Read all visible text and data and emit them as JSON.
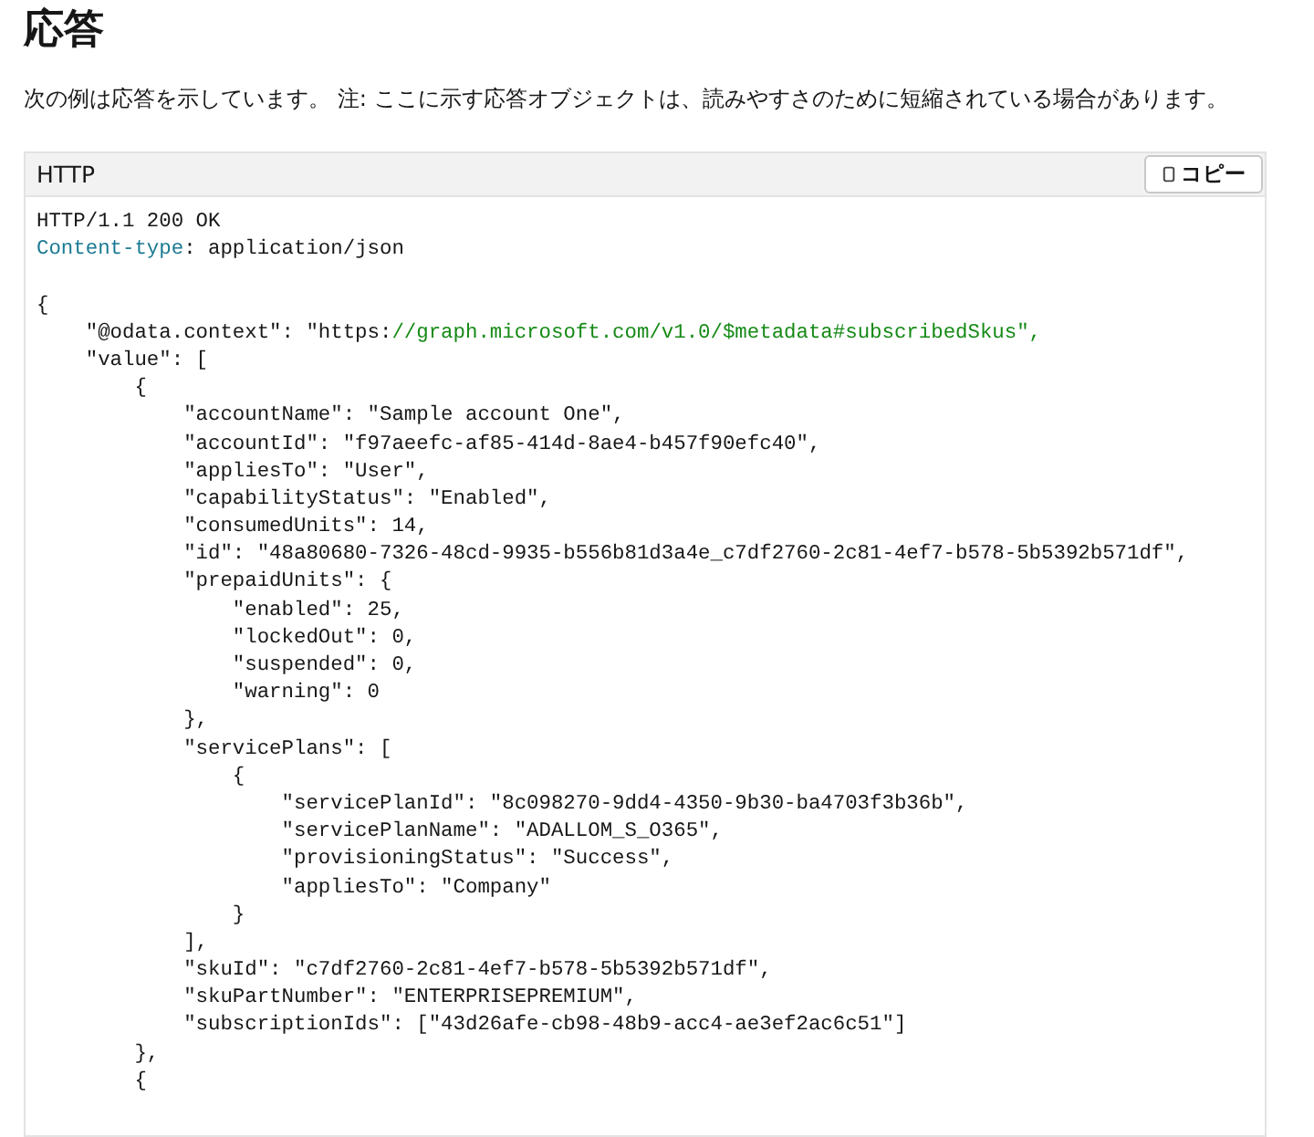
{
  "heading": "応答",
  "description": "次の例は応答を示しています。 注: ここに示す応答オブジェクトは、読みやすさのために短縮されている場合があります。",
  "code_block": {
    "language": "HTTP",
    "copy_button": "コピー",
    "lines": [
      {
        "segments": [
          {
            "kind": "plain",
            "text": "HTTP/1.1 200 OK"
          }
        ]
      },
      {
        "segments": [
          {
            "kind": "header",
            "text": "Content-type"
          },
          {
            "kind": "plain",
            "text": ": application/json"
          }
        ]
      },
      {
        "kind": "blank"
      },
      {
        "segments": [
          {
            "kind": "plain",
            "text": "{"
          }
        ]
      },
      {
        "segments": [
          {
            "kind": "plain",
            "text": "    \"@odata.context\": \"https:"
          },
          {
            "kind": "url",
            "text": "//graph.microsoft.com/v1.0/$metadata#subscribedSkus\","
          }
        ]
      },
      {
        "segments": [
          {
            "kind": "plain",
            "text": "    \"value\": ["
          }
        ]
      },
      {
        "segments": [
          {
            "kind": "plain",
            "text": "        {"
          }
        ]
      },
      {
        "segments": [
          {
            "kind": "plain",
            "text": "            \"accountName\": \"Sample account One\","
          }
        ]
      },
      {
        "segments": [
          {
            "kind": "plain",
            "text": "            \"accountId\": \"f97aeefc-af85-414d-8ae4-b457f90efc40\","
          }
        ]
      },
      {
        "segments": [
          {
            "kind": "plain",
            "text": "            \"appliesTo\": \"User\","
          }
        ]
      },
      {
        "segments": [
          {
            "kind": "plain",
            "text": "            \"capabilityStatus\": \"Enabled\","
          }
        ]
      },
      {
        "segments": [
          {
            "kind": "plain",
            "text": "            \"consumedUnits\": 14,"
          }
        ]
      },
      {
        "segments": [
          {
            "kind": "plain",
            "text": "            \"id\": \"48a80680-7326-48cd-9935-b556b81d3a4e_c7df2760-2c81-4ef7-b578-5b5392b571df\","
          }
        ]
      },
      {
        "segments": [
          {
            "kind": "plain",
            "text": "            \"prepaidUnits\": {"
          }
        ]
      },
      {
        "segments": [
          {
            "kind": "plain",
            "text": "                \"enabled\": 25,"
          }
        ]
      },
      {
        "segments": [
          {
            "kind": "plain",
            "text": "                \"lockedOut\": 0,"
          }
        ]
      },
      {
        "segments": [
          {
            "kind": "plain",
            "text": "                \"suspended\": 0,"
          }
        ]
      },
      {
        "segments": [
          {
            "kind": "plain",
            "text": "                \"warning\": 0"
          }
        ]
      },
      {
        "segments": [
          {
            "kind": "plain",
            "text": "            },"
          }
        ]
      },
      {
        "segments": [
          {
            "kind": "plain",
            "text": "            \"servicePlans\": ["
          }
        ]
      },
      {
        "segments": [
          {
            "kind": "plain",
            "text": "                {"
          }
        ]
      },
      {
        "segments": [
          {
            "kind": "plain",
            "text": "                    \"servicePlanId\": \"8c098270-9dd4-4350-9b30-ba4703f3b36b\","
          }
        ]
      },
      {
        "segments": [
          {
            "kind": "plain",
            "text": "                    \"servicePlanName\": \"ADALLOM_S_O365\","
          }
        ]
      },
      {
        "segments": [
          {
            "kind": "plain",
            "text": "                    \"provisioningStatus\": \"Success\","
          }
        ]
      },
      {
        "segments": [
          {
            "kind": "plain",
            "text": "                    \"appliesTo\": \"Company\""
          }
        ]
      },
      {
        "segments": [
          {
            "kind": "plain",
            "text": "                }"
          }
        ]
      },
      {
        "segments": [
          {
            "kind": "plain",
            "text": "            ],"
          }
        ]
      },
      {
        "segments": [
          {
            "kind": "plain",
            "text": "            \"skuId\": \"c7df2760-2c81-4ef7-b578-5b5392b571df\","
          }
        ]
      },
      {
        "segments": [
          {
            "kind": "plain",
            "text": "            \"skuPartNumber\": \"ENTERPRISEPREMIUM\","
          }
        ]
      },
      {
        "segments": [
          {
            "kind": "plain",
            "text": "            \"subscriptionIds\": [\"43d26afe-cb98-48b9-acc4-ae3ef2ac6c51\"]"
          }
        ]
      },
      {
        "segments": [
          {
            "kind": "plain",
            "text": "        },"
          }
        ]
      },
      {
        "segments": [
          {
            "kind": "plain",
            "text": "        {"
          }
        ]
      }
    ]
  }
}
